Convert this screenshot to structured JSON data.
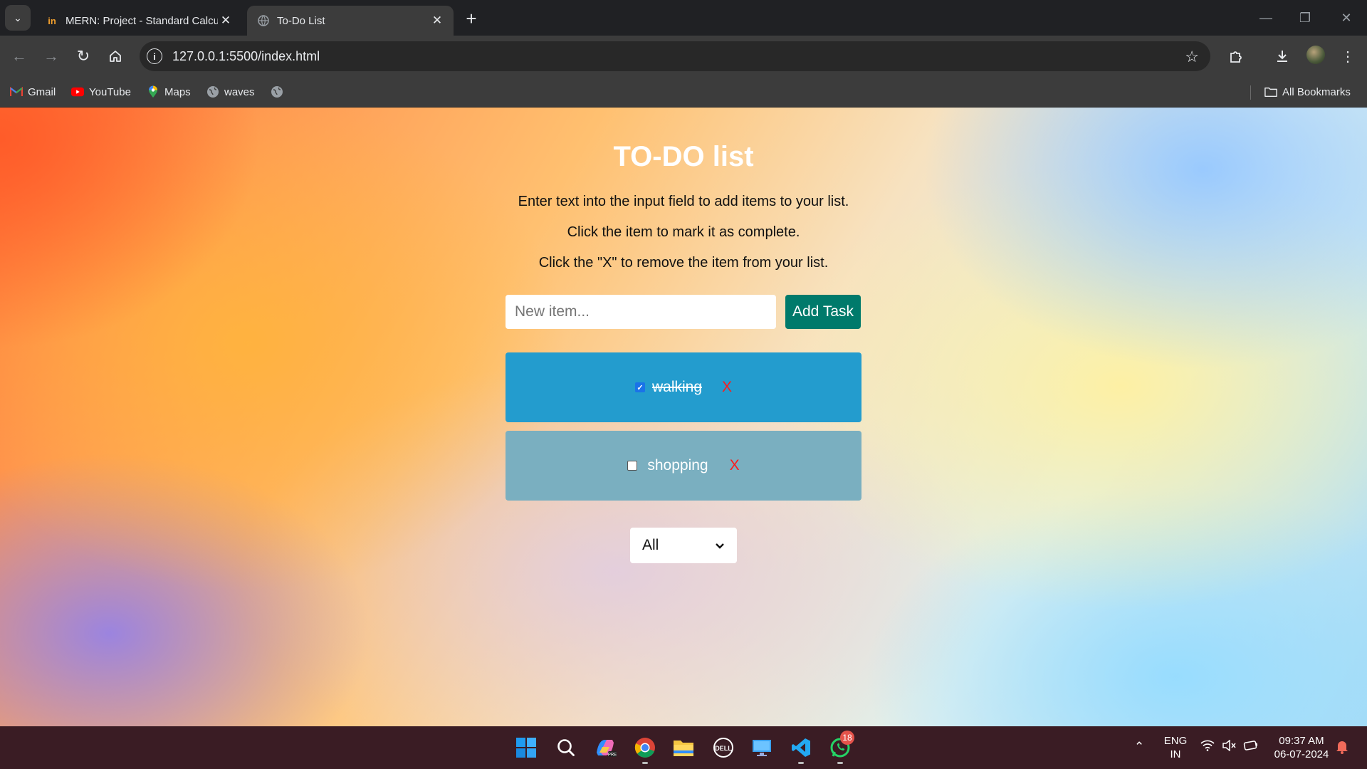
{
  "browser": {
    "tabs": [
      {
        "title": "MERN: Project - Standard Calcu",
        "favicon": "in-logo-icon",
        "active": false
      },
      {
        "title": "To-Do List",
        "favicon": "globe-icon",
        "active": true
      }
    ],
    "url": "127.0.0.1:5500/index.html",
    "bookmarks": [
      {
        "label": "Gmail",
        "icon": "gmail-icon"
      },
      {
        "label": "YouTube",
        "icon": "youtube-icon"
      },
      {
        "label": "Maps",
        "icon": "maps-icon"
      },
      {
        "label": "waves",
        "icon": "globe-icon"
      },
      {
        "label": "",
        "icon": "globe-icon"
      }
    ],
    "all_bookmarks_label": "All Bookmarks"
  },
  "app": {
    "title": "TO-DO list",
    "instructions": [
      "Enter text into the input field to add items to your list.",
      "Click the item to mark it as complete.",
      "Click the \"X\" to remove the item from your list."
    ],
    "input_placeholder": "New item...",
    "add_button_label": "Add Task",
    "todos": [
      {
        "text": "walking",
        "completed": true,
        "delete_label": "X"
      },
      {
        "text": "shopping",
        "completed": false,
        "delete_label": "X"
      }
    ],
    "filter": {
      "selected": "All"
    }
  },
  "taskbar": {
    "apps": [
      "windows-start-icon",
      "search-icon",
      "copilot-icon",
      "chrome-icon",
      "file-explorer-icon",
      "dell-icon",
      "desktop-icon",
      "vscode-icon",
      "whatsapp-icon"
    ],
    "whatsapp_badge": "18",
    "language": "ENG",
    "region": "IN",
    "time": "09:37 AM",
    "date": "06-07-2024"
  },
  "colors": {
    "browser_frame": "#202124",
    "toolbar": "#3c3c3c",
    "completed_item": "#239cce",
    "pending_item": "#7aafc0",
    "add_button": "#007a6b",
    "delete_x": "#ff1a1a",
    "taskbar": "#3a1c24"
  }
}
